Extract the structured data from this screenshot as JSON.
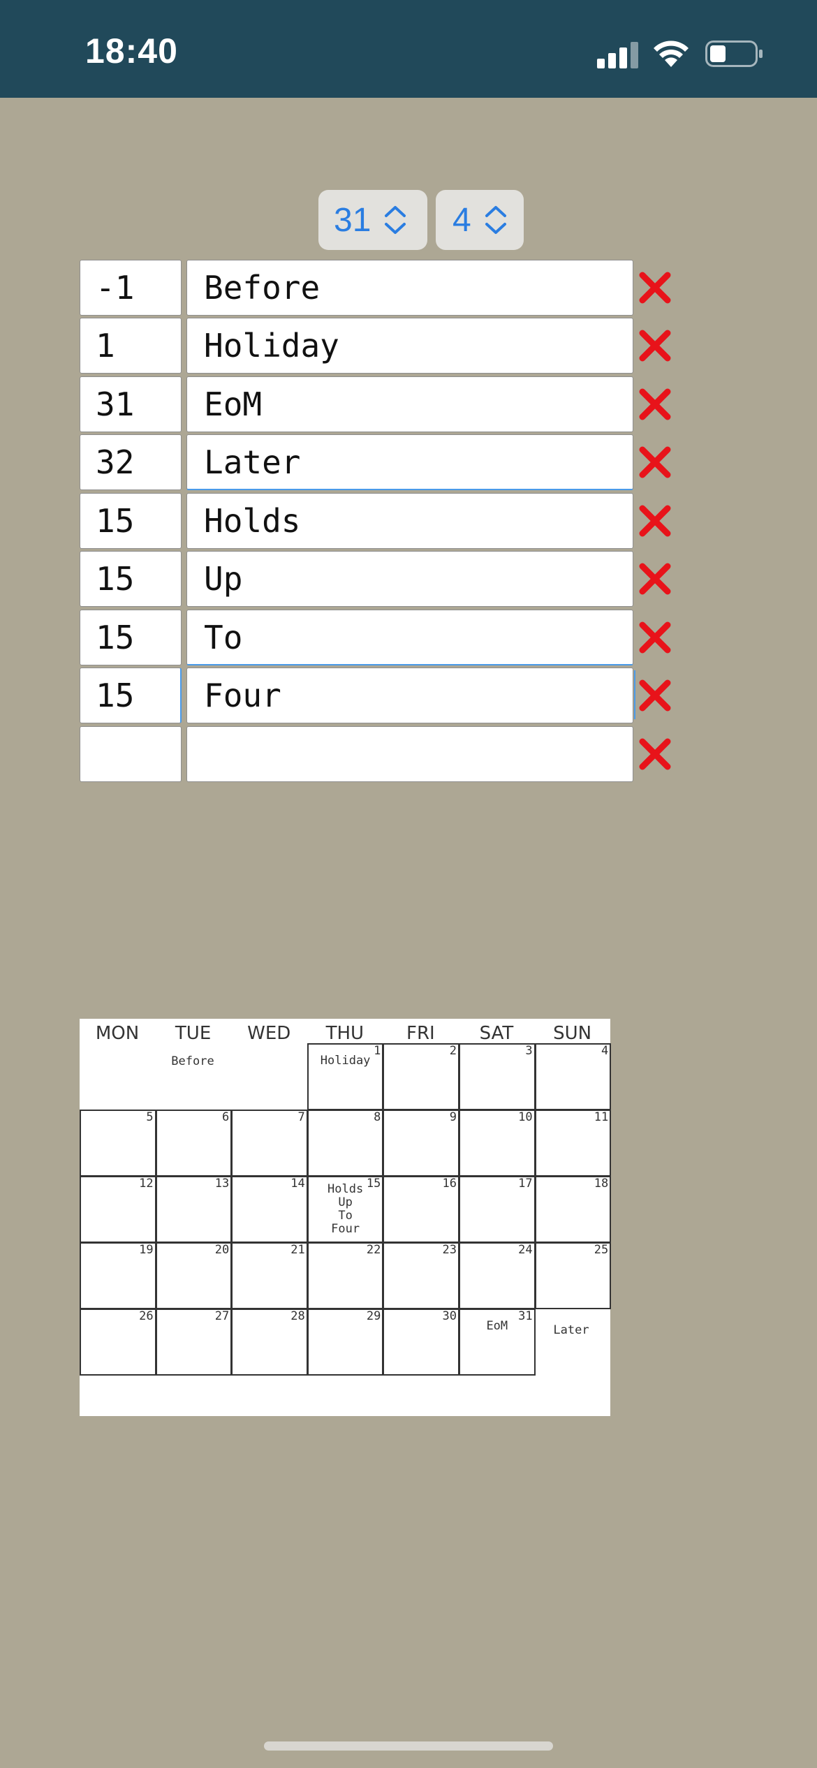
{
  "status_bar": {
    "time": "18:40"
  },
  "steppers": {
    "month_days": "31",
    "first_weekday": "4"
  },
  "entries": [
    {
      "day": "-1",
      "label": "Before"
    },
    {
      "day": "1",
      "label": "Holiday"
    },
    {
      "day": "31",
      "label": "EoM"
    },
    {
      "day": "32",
      "label": "Later"
    },
    {
      "day": "15",
      "label": "Holds"
    },
    {
      "day": "15",
      "label": "Up"
    },
    {
      "day": "15",
      "label": "To"
    },
    {
      "day": "15",
      "label": "Four"
    },
    {
      "day": "",
      "label": ""
    }
  ],
  "calendar": {
    "weekdays": [
      "MON",
      "TUE",
      "WED",
      "THU",
      "FRI",
      "SAT",
      "SUN"
    ],
    "before_label": "Before",
    "after_label": "Later",
    "days": [
      {
        "n": "1",
        "events": [
          "Holiday"
        ]
      },
      {
        "n": "2",
        "events": []
      },
      {
        "n": "3",
        "events": []
      },
      {
        "n": "4",
        "events": []
      },
      {
        "n": "5",
        "events": []
      },
      {
        "n": "6",
        "events": []
      },
      {
        "n": "7",
        "events": []
      },
      {
        "n": "8",
        "events": []
      },
      {
        "n": "9",
        "events": []
      },
      {
        "n": "10",
        "events": []
      },
      {
        "n": "11",
        "events": []
      },
      {
        "n": "12",
        "events": []
      },
      {
        "n": "13",
        "events": []
      },
      {
        "n": "14",
        "events": []
      },
      {
        "n": "15",
        "events": [
          "Holds",
          "Up",
          "To",
          "Four"
        ]
      },
      {
        "n": "16",
        "events": []
      },
      {
        "n": "17",
        "events": []
      },
      {
        "n": "18",
        "events": []
      },
      {
        "n": "19",
        "events": []
      },
      {
        "n": "20",
        "events": []
      },
      {
        "n": "21",
        "events": []
      },
      {
        "n": "22",
        "events": []
      },
      {
        "n": "23",
        "events": []
      },
      {
        "n": "24",
        "events": []
      },
      {
        "n": "25",
        "events": []
      },
      {
        "n": "26",
        "events": []
      },
      {
        "n": "27",
        "events": []
      },
      {
        "n": "28",
        "events": []
      },
      {
        "n": "29",
        "events": []
      },
      {
        "n": "30",
        "events": []
      },
      {
        "n": "31",
        "events": [
          "EoM"
        ]
      }
    ]
  },
  "colors": {
    "background": "#ada794",
    "status_bar": "#21495a",
    "accent": "#2a7de1",
    "delete": "#e8131a"
  }
}
